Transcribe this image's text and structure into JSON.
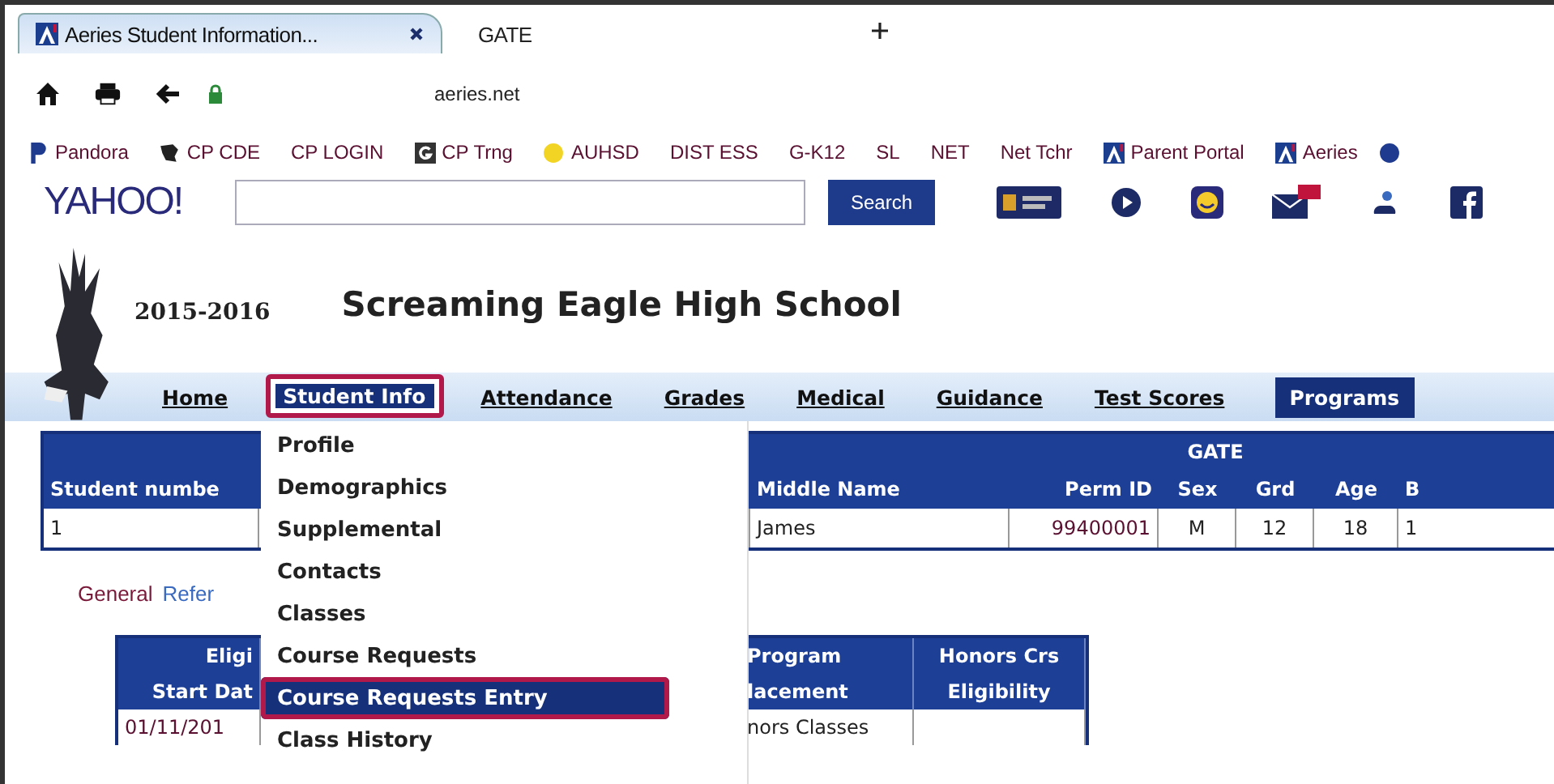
{
  "browser": {
    "tabs": [
      {
        "label": "Aeries Student Information...",
        "selected": true
      },
      {
        "label": "GATE",
        "selected": false
      }
    ],
    "address": "aeries.net",
    "bookmarks": [
      {
        "label": "Pandora",
        "kind": "p"
      },
      {
        "label": "CP CDE",
        "kind": "shape"
      },
      {
        "label": "CP LOGIN",
        "kind": "none"
      },
      {
        "label": "CP Trng",
        "kind": "g"
      },
      {
        "label": "AUHSD",
        "kind": "dot"
      },
      {
        "label": "DIST ESS",
        "kind": "none"
      },
      {
        "label": "G-K12",
        "kind": "none"
      },
      {
        "label": "SL",
        "kind": "none"
      },
      {
        "label": "NET",
        "kind": "none"
      },
      {
        "label": "Net Tchr",
        "kind": "none"
      },
      {
        "label": "Parent Portal",
        "kind": "a"
      },
      {
        "label": "Aeries",
        "kind": "a"
      }
    ]
  },
  "yahoo": {
    "logo": "YAHOO!",
    "search_button": "Search"
  },
  "school": {
    "year": "2015-2016",
    "name": "Screaming Eagle High School"
  },
  "nav": [
    {
      "label": "Home",
      "selected": false,
      "open": false
    },
    {
      "label": "Student Info",
      "selected": true,
      "open": true
    },
    {
      "label": "Attendance",
      "selected": false,
      "open": false
    },
    {
      "label": "Grades",
      "selected": false,
      "open": false
    },
    {
      "label": "Medical",
      "selected": false,
      "open": false
    },
    {
      "label": "Guidance",
      "selected": false,
      "open": false
    },
    {
      "label": "Test Scores",
      "selected": false,
      "open": false
    },
    {
      "label": "Programs",
      "selected": true,
      "open": false
    }
  ],
  "menu": [
    {
      "label": "Profile",
      "selected": false
    },
    {
      "label": "Demographics",
      "selected": false
    },
    {
      "label": "Supplemental",
      "selected": false
    },
    {
      "label": "Contacts",
      "selected": false
    },
    {
      "label": "Classes",
      "selected": false
    },
    {
      "label": "Course Requests",
      "selected": false
    },
    {
      "label": "Course Requests Entry",
      "selected": true
    },
    {
      "label": "Class History",
      "selected": false
    }
  ],
  "student_table": {
    "title": "GATE",
    "columns": [
      "Student numbe",
      "Middle Name",
      "Perm ID",
      "Sex",
      "Grd",
      "Age",
      "B"
    ],
    "rows": [
      [
        "1",
        "James",
        "99400001",
        "M",
        "12",
        "18",
        "1"
      ]
    ]
  },
  "links": [
    "General",
    "Refer"
  ],
  "eligibility_table": {
    "columns": [
      {
        "top": "Eligi",
        "bottom": "Start Dat"
      },
      {
        "top": "Program",
        "bottom": "lacement"
      },
      {
        "top": "Honors Crs",
        "bottom": "Eligibility"
      }
    ],
    "rows": [
      [
        "01/11/201",
        "nors Classes"
      ]
    ]
  }
}
